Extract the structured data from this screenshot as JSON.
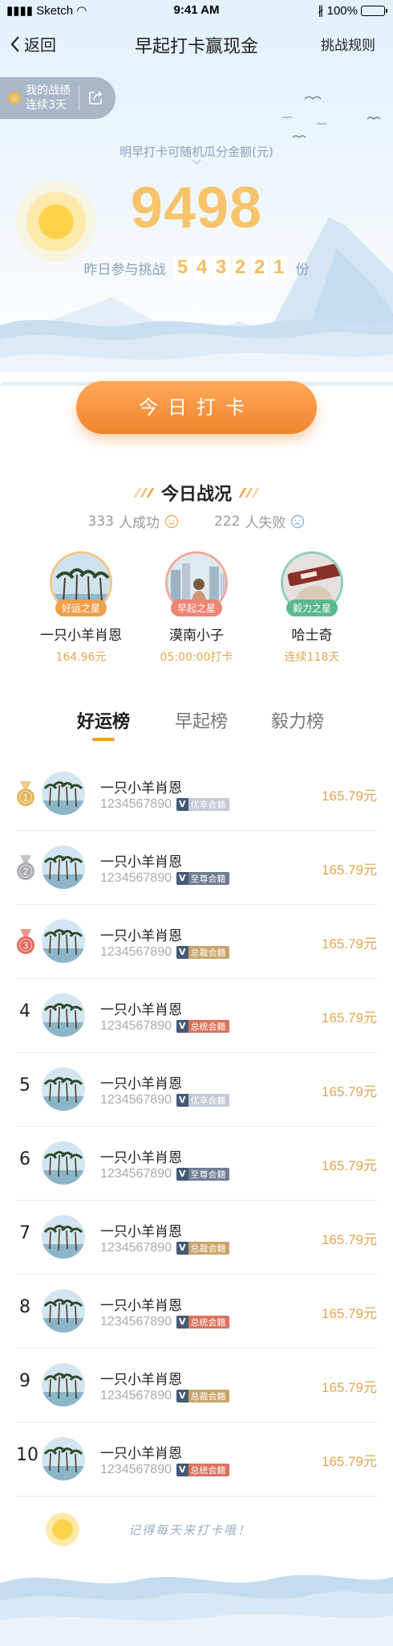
{
  "status_bar": {
    "carrier": "Sketch",
    "time": "9:41 AM",
    "battery": "100%"
  },
  "nav": {
    "back_label": "返回",
    "title": "早起打卡赢现金",
    "rules_label": "挑战规则"
  },
  "record": {
    "line1": "我的战绩",
    "line2": "连续3天"
  },
  "pool": {
    "label": "明早打卡可随机瓜分金额(元)",
    "amount": "9498",
    "yesterday_prefix": "昨日参与挑战",
    "yesterday_digits": [
      "5",
      "4",
      "3",
      "2",
      "2",
      "1"
    ],
    "yesterday_suffix": "份"
  },
  "checkin_button": "今日打卡",
  "today": {
    "title": "今日战况",
    "success_count": "333",
    "success_label": "人成功",
    "fail_count": "222",
    "fail_label": "人失败"
  },
  "stars": [
    {
      "badge": "好运之星",
      "name": "一只小羊肖恩",
      "sub": "164.96元",
      "color": "#f0a04b"
    },
    {
      "badge": "早起之星",
      "name": "漠南小子",
      "sub": "05:00:00打卡",
      "color": "#ee8474"
    },
    {
      "badge": "毅力之星",
      "name": "哈士奇",
      "sub": "连续118天",
      "color": "#5cb88e"
    }
  ],
  "tabs": [
    "好运榜",
    "早起榜",
    "毅力榜"
  ],
  "ranking": [
    {
      "rank": "1",
      "name": "一只小羊肖恩",
      "id": "1234567890",
      "tag": "优享会籍",
      "tag_color": "#c3cad6",
      "amount": "165.79元"
    },
    {
      "rank": "2",
      "name": "一只小羊肖恩",
      "id": "1234567890",
      "tag": "至尊会籍",
      "tag_color": "#6f7d92",
      "amount": "165.79元"
    },
    {
      "rank": "3",
      "name": "一只小羊肖恩",
      "id": "1234567890",
      "tag": "总裁会籍",
      "tag_color": "#c9a46a",
      "amount": "165.79元"
    },
    {
      "rank": "4",
      "name": "一只小羊肖恩",
      "id": "1234567890",
      "tag": "总统会籍",
      "tag_color": "#d9735f",
      "amount": "165.79元"
    },
    {
      "rank": "5",
      "name": "一只小羊肖恩",
      "id": "1234567890",
      "tag": "优享会籍",
      "tag_color": "#c3cad6",
      "amount": "165.79元"
    },
    {
      "rank": "6",
      "name": "一只小羊肖恩",
      "id": "1234567890",
      "tag": "至尊会籍",
      "tag_color": "#6f7d92",
      "amount": "165.79元"
    },
    {
      "rank": "7",
      "name": "一只小羊肖恩",
      "id": "1234567890",
      "tag": "总裁会籍",
      "tag_color": "#c9a46a",
      "amount": "165.79元"
    },
    {
      "rank": "8",
      "name": "一只小羊肖恩",
      "id": "1234567890",
      "tag": "总统会籍",
      "tag_color": "#d9735f",
      "amount": "165.79元"
    },
    {
      "rank": "9",
      "name": "一只小羊肖恩",
      "id": "1234567890",
      "tag": "总裁会籍",
      "tag_color": "#c9a46a",
      "amount": "165.79元"
    },
    {
      "rank": "10",
      "name": "一只小羊肖恩",
      "id": "1234567890",
      "tag": "总统会籍",
      "tag_color": "#d9735f",
      "amount": "165.79元"
    }
  ],
  "medal_colors": {
    "1": "#e5b45a",
    "2": "#a9abb0",
    "3": "#e46a5a"
  },
  "footer_reminder": "记得每天来打卡哦！"
}
